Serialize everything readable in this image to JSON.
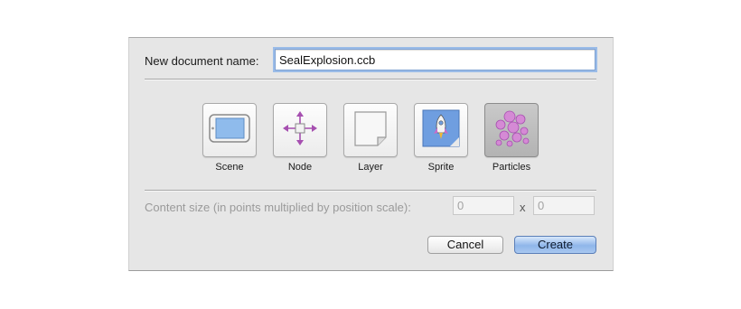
{
  "dialog": {
    "name_label": "New document name:",
    "name_value": "SealExplosion.ccb",
    "types": [
      {
        "label": "Scene",
        "icon": "scene-icon",
        "selected": false
      },
      {
        "label": "Node",
        "icon": "node-icon",
        "selected": false
      },
      {
        "label": "Layer",
        "icon": "layer-icon",
        "selected": false
      },
      {
        "label": "Sprite",
        "icon": "sprite-icon",
        "selected": false
      },
      {
        "label": "Particles",
        "icon": "particles-icon",
        "selected": true
      }
    ],
    "content_size_label": "Content size (in points multiplied by position scale):",
    "width_value": "0",
    "height_value": "0",
    "times_symbol": "x",
    "cancel_label": "Cancel",
    "create_label": "Create"
  },
  "colors": {
    "accent": "#7fa2d3",
    "particles": "#c86bc8",
    "node_arrows": "#a64fb0"
  }
}
